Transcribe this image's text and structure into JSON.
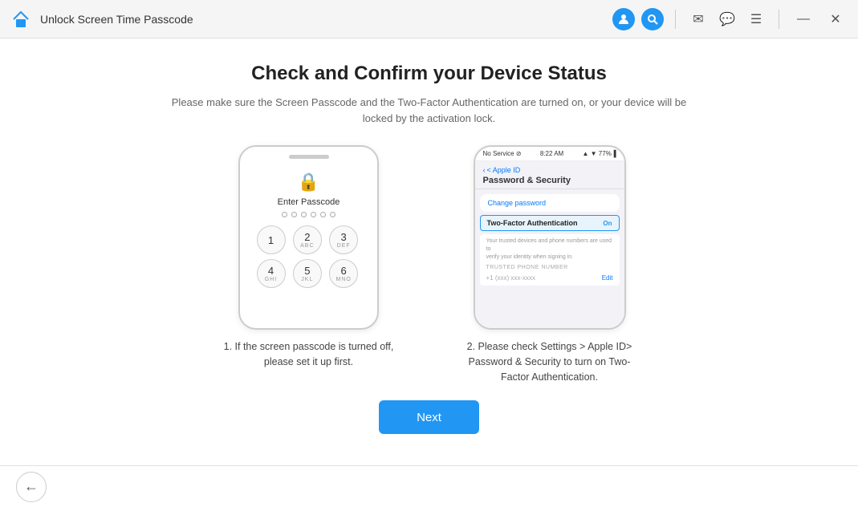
{
  "titleBar": {
    "title": "Unlock Screen Time Passcode",
    "homeIcon": "🏠",
    "userIcon": "👤",
    "searchIcon": "🔍",
    "mailIcon": "✉",
    "chatIcon": "💬",
    "menuIcon": "☰",
    "minimizeIcon": "—",
    "closeIcon": "✕"
  },
  "page": {
    "title": "Check and Confirm your Device Status",
    "subtitle": "Please make sure the Screen Passcode and the Two-Factor Authentication are turned on, or your device will be locked by the activation lock."
  },
  "device1": {
    "enterPasscodeLabel": "Enter Passcode",
    "keys": [
      {
        "num": "1",
        "sub": ""
      },
      {
        "num": "2",
        "sub": "ABC"
      },
      {
        "num": "3",
        "sub": "DEF"
      },
      {
        "num": "4",
        "sub": "GHI"
      },
      {
        "num": "5",
        "sub": "JKL"
      },
      {
        "num": "6",
        "sub": "MNO"
      }
    ],
    "caption": "1. If the screen passcode is turned off, please set it up first."
  },
  "device2": {
    "statusBar": {
      "left": "No Service ⊘",
      "center": "8:22 AM",
      "right": "▲ ▼ 77%▐"
    },
    "backLabel": "< Apple ID",
    "headerTitle": "Password & Security",
    "changePassword": "Change password",
    "twoFactor": "Two-Factor Authentication",
    "twoFactorStatus": "On",
    "descLine1": "Your trusted devices and phone numbers are used to",
    "descLine2": "verify your identity when signing in.",
    "trustedPhoneLabel": "TRUSTED PHONE NUMBER",
    "editLabel": "Edit",
    "caption": "2. Please check Settings > Apple ID> Password & Security to turn on Two-Factor Authentication."
  },
  "nextButton": {
    "label": "Next"
  },
  "backButton": {
    "icon": "←"
  }
}
